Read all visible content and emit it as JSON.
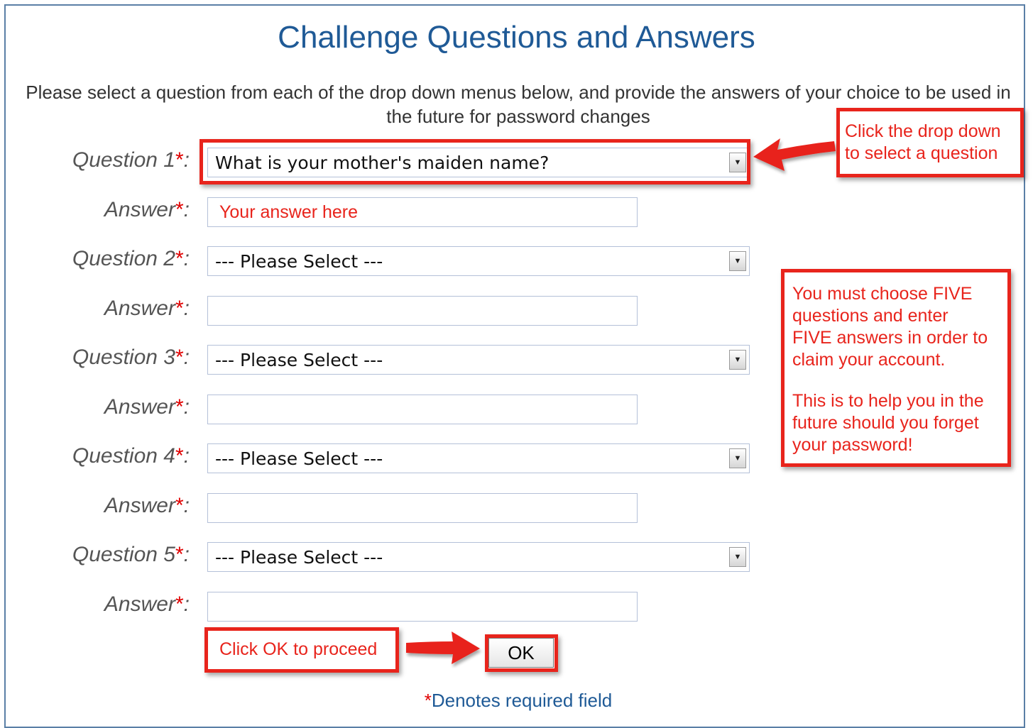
{
  "title": "Challenge Questions and Answers",
  "intro": "Please select a question from each of the drop down menus below, and provide the answers of your choice to be used in the future for password changes",
  "required_star": "*",
  "colon": ":",
  "questions": [
    {
      "label": "Question 1",
      "selected": "What is your mother's maiden name?",
      "answer_label": "Answer",
      "answer_placeholder": "Your answer here"
    },
    {
      "label": "Question 2",
      "selected": "--- Please Select ---",
      "answer_label": "Answer",
      "answer_placeholder": ""
    },
    {
      "label": "Question 3",
      "selected": "--- Please Select ---",
      "answer_label": "Answer",
      "answer_placeholder": ""
    },
    {
      "label": "Question 4",
      "selected": "--- Please Select ---",
      "answer_label": "Answer",
      "answer_placeholder": ""
    },
    {
      "label": "Question 5",
      "selected": "--- Please Select ---",
      "answer_label": "Answer",
      "answer_placeholder": ""
    }
  ],
  "callouts": {
    "dropdown_line1": "Click the drop down",
    "dropdown_line2": "to select a question",
    "five_p1_l1": "You must choose FIVE",
    "five_p1_l2": "questions and enter",
    "five_p1_l3": "FIVE answers in order to",
    "five_p1_l4": "claim your account.",
    "five_p2_l1": "This is to help you in the",
    "five_p2_l2": "future should you forget",
    "five_p2_l3": "your password!",
    "ok": "Click OK to proceed"
  },
  "ok_label": "OK",
  "required_note": "Denotes required field",
  "icons": {
    "dropdown": "chevron-down-icon",
    "arrow": "red-arrow-icon"
  },
  "colors": {
    "title": "#1f5a96",
    "annotation": "#e8241c",
    "required": "#e00000"
  }
}
